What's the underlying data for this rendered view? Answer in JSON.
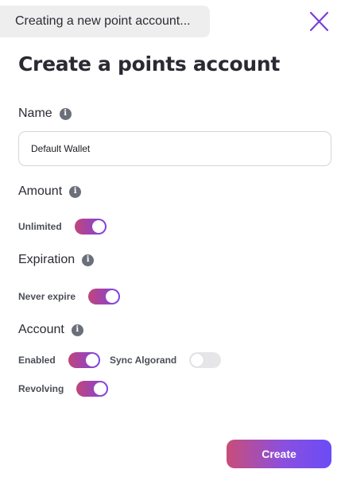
{
  "status": {
    "text": "Creating a new point account..."
  },
  "close": {
    "icon": "close-icon",
    "color": "#7b3fd6"
  },
  "title": "Create a points account",
  "name_section": {
    "label": "Name",
    "info_icon": "info-icon",
    "input_value": "Default Wallet"
  },
  "amount_section": {
    "label": "Amount",
    "toggles": [
      {
        "label": "Unlimited",
        "on": true
      }
    ]
  },
  "expiration_section": {
    "label": "Expiration",
    "toggles": [
      {
        "label": "Never expire",
        "on": true
      }
    ]
  },
  "account_section": {
    "label": "Account",
    "toggles": [
      {
        "label": "Enabled",
        "on": true
      },
      {
        "label": "Sync Algorand",
        "on": false
      },
      {
        "label": "Revolving",
        "on": true
      }
    ]
  },
  "actions": {
    "create_label": "Create"
  },
  "colors": {
    "accent_start": "#c1457a",
    "accent_end": "#7b43e6",
    "toggle_off": "#e6e6e8"
  }
}
